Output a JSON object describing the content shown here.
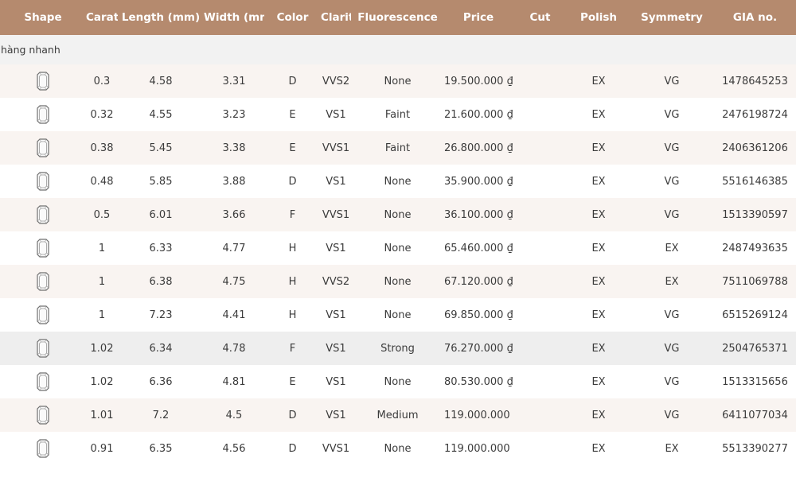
{
  "columns": {
    "shape": "Shape",
    "carat": "Carat",
    "length": "Length (mm)",
    "width": "Width (mm)",
    "color": "Color",
    "clarity": "Clarity",
    "fluorescence": "Fluorescence",
    "price": "Price",
    "cut": "Cut",
    "polish": "Polish",
    "symmetry": "Symmetry",
    "gia": "GIA no."
  },
  "group_label": "hàng nhanh",
  "shape_icon": "emerald-cut-diamond-icon",
  "colors": {
    "header_bg": "#b58a6e",
    "alt_row_bg": "#f9f4f1",
    "highlight_row_bg": "#eeeeee",
    "group_bg": "#f2f2f2"
  },
  "rows": [
    {
      "carat": "0.3",
      "length": "4.58",
      "width": "3.31",
      "color": "D",
      "clarity": "VVS2",
      "fluorescence": "None",
      "price": "19.500.000 ₫",
      "cut": "",
      "polish": "EX",
      "symmetry": "VG",
      "gia": "1478645253"
    },
    {
      "carat": "0.32",
      "length": "4.55",
      "width": "3.23",
      "color": "E",
      "clarity": "VS1",
      "fluorescence": "Faint",
      "price": "21.600.000 ₫",
      "cut": "",
      "polish": "EX",
      "symmetry": "VG",
      "gia": "2476198724"
    },
    {
      "carat": "0.38",
      "length": "5.45",
      "width": "3.38",
      "color": "E",
      "clarity": "VVS1",
      "fluorescence": "Faint",
      "price": "26.800.000 ₫",
      "cut": "",
      "polish": "EX",
      "symmetry": "VG",
      "gia": "2406361206"
    },
    {
      "carat": "0.48",
      "length": "5.85",
      "width": "3.88",
      "color": "D",
      "clarity": "VS1",
      "fluorescence": "None",
      "price": "35.900.000 ₫",
      "cut": "",
      "polish": "EX",
      "symmetry": "VG",
      "gia": "5516146385"
    },
    {
      "carat": "0.5",
      "length": "6.01",
      "width": "3.66",
      "color": "F",
      "clarity": "VVS1",
      "fluorescence": "None",
      "price": "36.100.000 ₫",
      "cut": "",
      "polish": "EX",
      "symmetry": "VG",
      "gia": "1513390597"
    },
    {
      "carat": "1",
      "length": "6.33",
      "width": "4.77",
      "color": "H",
      "clarity": "VS1",
      "fluorescence": "None",
      "price": "65.460.000 ₫",
      "cut": "",
      "polish": "EX",
      "symmetry": "EX",
      "gia": "2487493635"
    },
    {
      "carat": "1",
      "length": "6.38",
      "width": "4.75",
      "color": "H",
      "clarity": "VVS2",
      "fluorescence": "None",
      "price": "67.120.000 ₫",
      "cut": "",
      "polish": "EX",
      "symmetry": "EX",
      "gia": "7511069788"
    },
    {
      "carat": "1",
      "length": "7.23",
      "width": "4.41",
      "color": "H",
      "clarity": "VS1",
      "fluorescence": "None",
      "price": "69.850.000 ₫",
      "cut": "",
      "polish": "EX",
      "symmetry": "VG",
      "gia": "6515269124"
    },
    {
      "carat": "1.02",
      "length": "6.34",
      "width": "4.78",
      "color": "F",
      "clarity": "VS1",
      "fluorescence": "Strong",
      "price": "76.270.000 ₫",
      "cut": "",
      "polish": "EX",
      "symmetry": "VG",
      "gia": "2504765371"
    },
    {
      "carat": "1.02",
      "length": "6.36",
      "width": "4.81",
      "color": "E",
      "clarity": "VS1",
      "fluorescence": "None",
      "price": "80.530.000 ₫",
      "cut": "",
      "polish": "EX",
      "symmetry": "VG",
      "gia": "1513315656"
    },
    {
      "carat": "1.01",
      "length": "7.2",
      "width": "4.5",
      "color": "D",
      "clarity": "VS1",
      "fluorescence": "Medium",
      "price": "119.000.000 ₫",
      "cut": "",
      "polish": "EX",
      "symmetry": "VG",
      "gia": "6411077034"
    },
    {
      "carat": "0.91",
      "length": "6.35",
      "width": "4.56",
      "color": "D",
      "clarity": "VVS1",
      "fluorescence": "None",
      "price": "119.000.000 ₫",
      "cut": "",
      "polish": "EX",
      "symmetry": "EX",
      "gia": "5513390277"
    }
  ]
}
